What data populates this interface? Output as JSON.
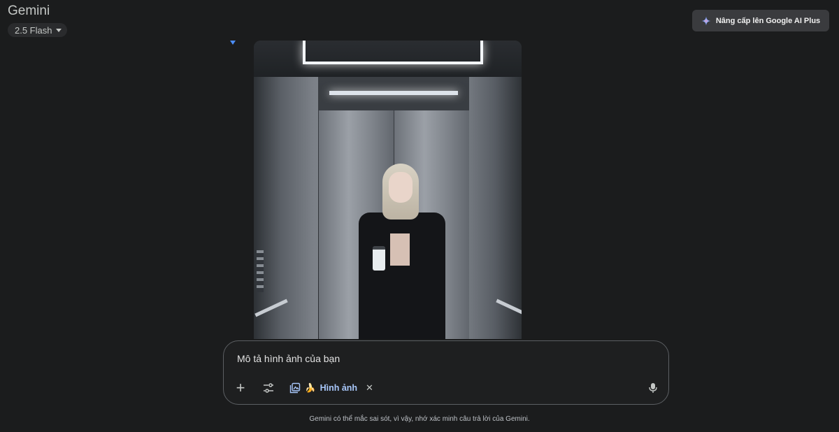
{
  "header": {
    "app_title": "Gemini",
    "model_label": "2.5 Flash",
    "model_icon": "chevron-down-icon",
    "upgrade_label": "Nâng cấp lên Google AI Plus",
    "upgrade_icon": "sparkle-icon"
  },
  "image": {
    "icon": "elevator-portrait-image"
  },
  "composer": {
    "prompt_value": "Mô tả hình ảnh của bạn",
    "add_icon": "plus-icon",
    "tools_icon": "tune-icon",
    "chip_label": "Hình ảnh",
    "chip_icon": "image-collection-icon",
    "chip_emoji": "🍌",
    "chip_close_icon": "close-icon",
    "mic_icon": "microphone-icon"
  },
  "footer": {
    "disclaimer": "Gemini có thể mắc sai sót, vì vậy, nhớ xác minh câu trả lời của Gemini."
  },
  "colors": {
    "background": "#1b1c1d",
    "accent": "#a8c7fa",
    "marker": "#4c8df6"
  }
}
